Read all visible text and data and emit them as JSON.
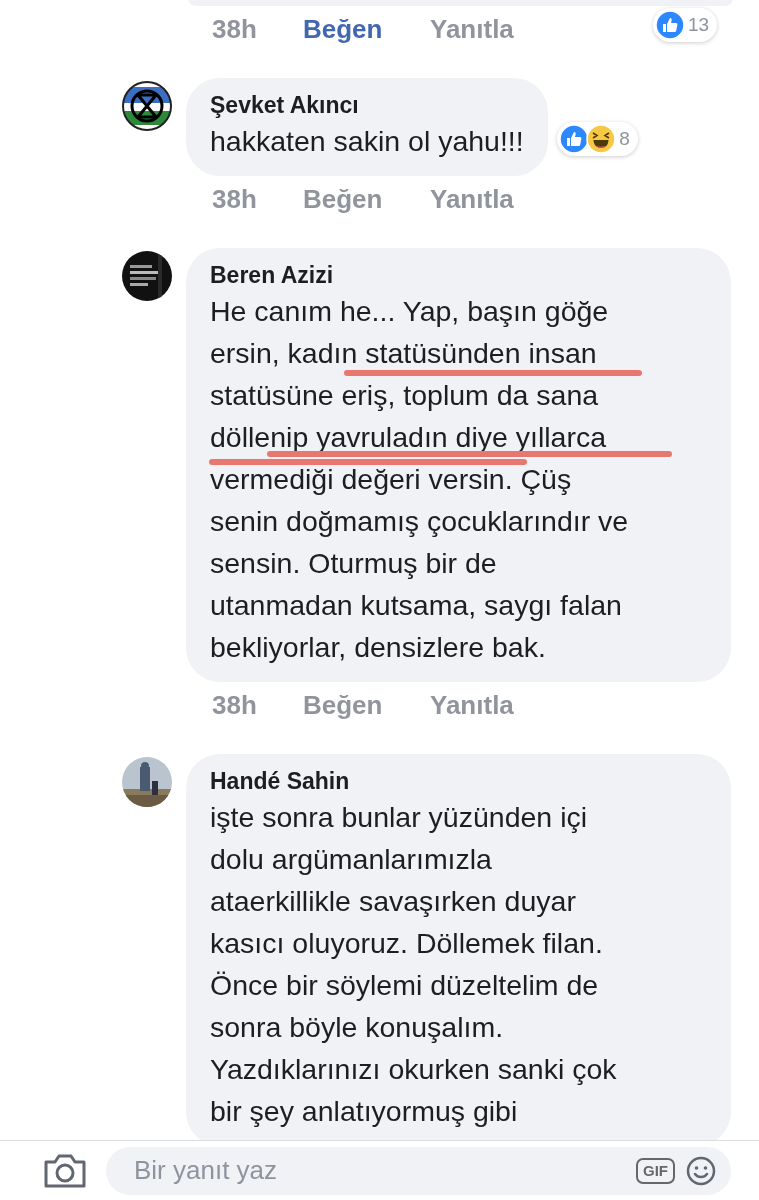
{
  "comments": [
    {
      "time": "38h",
      "like": "Beğen",
      "liked": true,
      "reply": "Yanıtla",
      "reactions": {
        "icons": [
          {
            "kind": "like"
          }
        ],
        "count": "13"
      }
    },
    {
      "author": "Şevket Akıncı",
      "avatar": {
        "kind": "emblem"
      },
      "text": "hakkaten sakin ol yahu!!!",
      "reactions": {
        "icons": [
          {
            "kind": "like"
          },
          {
            "kind": "haha"
          }
        ],
        "count": "8"
      },
      "time": "38h",
      "like": "Beğen",
      "liked": false,
      "reply": "Yanıtla"
    },
    {
      "author": "Beren Azizi",
      "text": "He canım he... Yap, başın göğe\nersin, kadın statüsünden insan\nstatüsüne eriş, toplum da sana\ndöllenip yavruladın diye yıllarca\nvermediği değeri versin. Çüş\nsenin doğmamış çocuklarındır ve\nsensin. Oturmuş bir de\nutanmadan kutsama, saygı falan\nbekliyorlar, densizlere bak.",
      "underlined": true,
      "time": "38h",
      "like": "Beğen",
      "liked": false,
      "reply": "Yanıtla"
    },
    {
      "author": "Handé Sahin",
      "text": "işte sonra bunlar yüzünden içi\ndolu argümanlarımızla\nataerkillikle savaşırken duyar\nkasıcı oluyoruz. Döllemek filan.\nÖnce bir söylemi düzeltelim de\nsonra böyle konuşalım.\nYazdıklarınızı okurken sanki çok\nbir şey anlatıyormuş gibi"
    }
  ],
  "composer": {
    "placeholder": "Bir yanıt yaz",
    "gif": "GIF"
  }
}
